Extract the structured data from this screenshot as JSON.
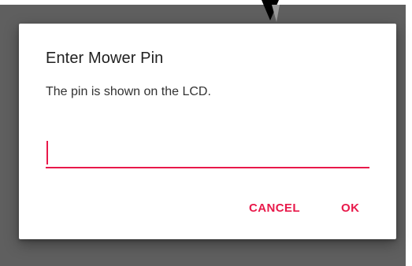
{
  "dialog": {
    "title": "Enter Mower Pin",
    "message": "The pin is shown on the LCD.",
    "pin_value": "",
    "buttons": {
      "cancel_label": "CANCEL",
      "ok_label": "OK"
    }
  },
  "colors": {
    "accent": "#e8194a",
    "scrim": "#5f5f5f",
    "dialog_background": "#ffffff",
    "title_text": "#212121"
  }
}
